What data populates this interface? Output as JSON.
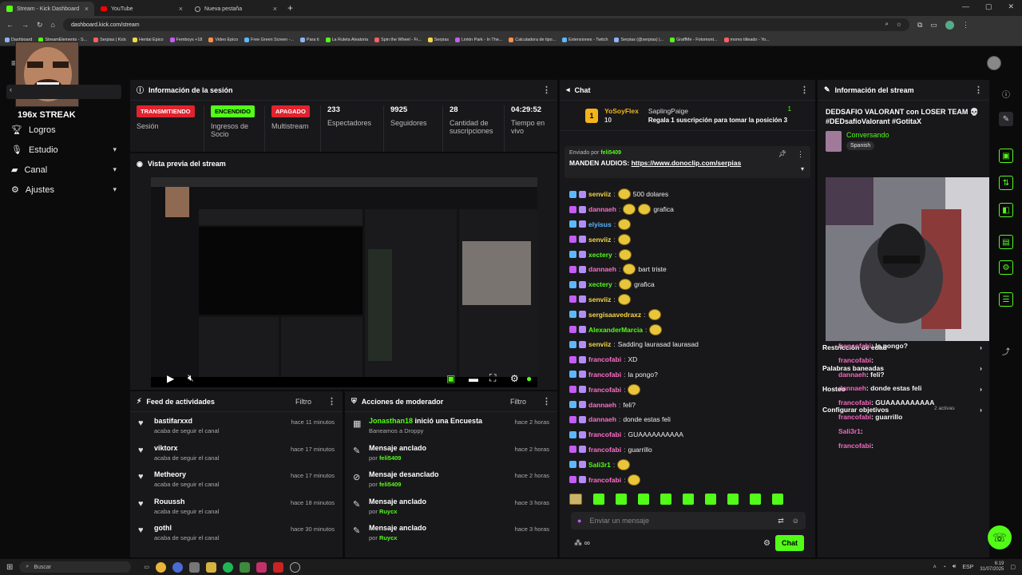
{
  "browser": {
    "tabs": [
      {
        "label": "Stream - Kick Dashboard",
        "color": "#53fc18"
      },
      {
        "label": "YouTube",
        "color": "#ff0000"
      },
      {
        "label": "Nueva pestaña",
        "color": "#5f6368"
      }
    ],
    "url": "dashboard.kick.com/stream",
    "bookmarks": [
      "Dashboard",
      "StreamElements - S...",
      "Serpias | Kick",
      "Hentai Epico",
      "Femboys +18",
      "Video Epico",
      "Free Green Screen -...",
      "Para ti",
      "La Ruleta Aleatoria",
      "Spin the Wheel - Fr...",
      "Serpias",
      "Linkin Park - In The...",
      "Calculadora de tipo...",
      "Extensiones - Twitch",
      "Serpias (@serpias) |...",
      "GraffMe - Fotomont...",
      "momo tilteado - Yo..."
    ]
  },
  "overlay": {
    "streak": "196x STREAK"
  },
  "nav": {
    "items": [
      {
        "label": "Logros",
        "chevron": false
      },
      {
        "label": "Estudio",
        "chevron": true
      },
      {
        "label": "Canal",
        "chevron": true
      },
      {
        "label": "Ajustes",
        "chevron": true
      }
    ]
  },
  "session": {
    "title": "Información de la sesión",
    "badges": [
      {
        "text": "TRANSMITIENDO",
        "label": "Sesión",
        "color": "#e0232e"
      },
      {
        "text": "ENCENDIDO",
        "label": "Ingresos de Socio",
        "color": "#53fc18"
      },
      {
        "text": "APAGADO",
        "label": "Multistream",
        "color": "#e0232e"
      }
    ],
    "stats": [
      {
        "value": "233",
        "label": "Espectadores"
      },
      {
        "value": "9925",
        "label": "Seguidores"
      },
      {
        "value": "28",
        "label": "Cantidad de suscripciones"
      },
      {
        "value": "04:29:52",
        "label": "Tiempo en vivo"
      }
    ]
  },
  "preview": {
    "title": "Vista previa del stream"
  },
  "activity": {
    "title": "Feed de actividades",
    "filter": "Filtro",
    "items": [
      {
        "user": "bastifarxxd",
        "action": "acaba de seguir el canal",
        "time": "hace 11 minutos"
      },
      {
        "user": "viktorx",
        "action": "acaba de seguir el canal",
        "time": "hace 17 minutos"
      },
      {
        "user": "Metheory",
        "action": "acaba de seguir el canal",
        "time": "hace 17 minutos"
      },
      {
        "user": "Rouussh",
        "action": "acaba de seguir el canal",
        "time": "hace 18 minutos"
      },
      {
        "user": "gothl",
        "action": "acaba de seguir el canal",
        "time": "hace 30 minutos"
      }
    ]
  },
  "modactions": {
    "title": "Acciones de moderador",
    "filter": "Filtro",
    "items": [
      {
        "title_user": "Jonasthan18",
        "title_rest": "inició una Encuesta",
        "sub_prefix": "",
        "sub_user": "",
        "sub_plain": "Baneamos a Droppy",
        "time": "hace 2 horas",
        "icon": "▦"
      },
      {
        "title_user": "",
        "title_rest": "Mensaje anclado",
        "sub_prefix": "por ",
        "sub_user": "feli5409",
        "sub_plain": "",
        "time": "hace 2 horas",
        "icon": "✎"
      },
      {
        "title_user": "",
        "title_rest": "Mensaje desanclado",
        "sub_prefix": "por ",
        "sub_user": "feli5409",
        "sub_plain": "",
        "time": "hace 2 horas",
        "icon": "⊘"
      },
      {
        "title_user": "",
        "title_rest": "Mensaje anclado",
        "sub_prefix": "por ",
        "sub_user": "Ruycx",
        "sub_plain": "",
        "time": "hace 3 horas",
        "icon": "✎"
      },
      {
        "title_user": "",
        "title_rest": "Mensaje anclado",
        "sub_prefix": "por ",
        "sub_user": "Ruycx",
        "sub_plain": "",
        "time": "hace 3 horas",
        "icon": "✎"
      }
    ]
  },
  "chat": {
    "title": "Chat",
    "top_gifter": {
      "name": "YoSoyFlex",
      "count": "10"
    },
    "gift": {
      "user": "SaplingPaige",
      "count": "1",
      "text": "Regala 1 suscripción para tomar la posición 3"
    },
    "pinned": {
      "sent_by_label": "Enviado por",
      "sent_by_user": "feli5409",
      "text": "MANDEN AUDIOS: ",
      "link": "https://www.donoclip.com/serpias"
    },
    "messages": [
      {
        "user": "senviiz",
        "color": "#f6d845",
        "text": "500 dolares",
        "emotes": 1
      },
      {
        "user": "dannaeh",
        "color": "#ff6ec7",
        "text": "grafica",
        "emotes": 2
      },
      {
        "user": "elyisus",
        "color": "#5db7ff",
        "text": "",
        "emotes": 1
      },
      {
        "user": "senviiz",
        "color": "#f6d845",
        "text": "",
        "emotes": 1
      },
      {
        "user": "xectery",
        "color": "#53fc18",
        "text": "",
        "emotes": 1
      },
      {
        "user": "dannaeh",
        "color": "#ff6ec7",
        "text": "bart triste",
        "emotes": 1
      },
      {
        "user": "xectery",
        "color": "#53fc18",
        "text": "grafica",
        "emotes": 1
      },
      {
        "user": "senviiz",
        "color": "#f6d845",
        "text": "",
        "emotes": 1
      },
      {
        "user": "sergisaavedraxz",
        "color": "#f6d845",
        "text": "",
        "emotes": 1
      },
      {
        "user": "AlexanderMarcia",
        "color": "#53fc18",
        "text": "",
        "emotes": 1
      },
      {
        "user": "senviiz",
        "color": "#f6d845",
        "text": "Sadding laurasad laurasad",
        "emotes": 0
      },
      {
        "user": "francofabi",
        "color": "#ff6ec7",
        "text": "XD",
        "emotes": 0
      },
      {
        "user": "francofabi",
        "color": "#ff6ec7",
        "text": "la pongo?",
        "emotes": 0
      },
      {
        "user": "francofabi",
        "color": "#ff6ec7",
        "text": "",
        "emotes": 1
      },
      {
        "user": "dannaeh",
        "color": "#ff6ec7",
        "text": "feli?",
        "emotes": 0
      },
      {
        "user": "dannaeh",
        "color": "#ff6ec7",
        "text": "donde estas feli",
        "emotes": 0
      },
      {
        "user": "francofabi",
        "color": "#ff6ec7",
        "text": "GUAAAAAAAAAA",
        "emotes": 0
      },
      {
        "user": "francofabi",
        "color": "#ff6ec7",
        "text": "guarrillo",
        "emotes": 0
      },
      {
        "user": "Sali3r1",
        "color": "#53fc18",
        "text": "",
        "emotes": 1
      },
      {
        "user": "francofabi",
        "color": "#ff6ec7",
        "text": "",
        "emotes": 1
      }
    ],
    "input_placeholder": "Enviar un mensaje",
    "send_label": "Chat"
  },
  "streaminfo": {
    "title": "Información del stream",
    "stream_title": "DEDSAFIO VALORANT con LOSER TEAM 💀 #DEDsafioValorant #GotitaX",
    "category": "Conversando",
    "language": "Spanish",
    "overlay_rows": [
      {
        "label": "Restricción de edad",
        "extra": ""
      },
      {
        "label": "Palabras baneadas",
        "extra": ""
      },
      {
        "label": "Hosteo",
        "extra": ""
      },
      {
        "label": "Configurar objetivos",
        "extra": "2 activas"
      }
    ],
    "overlay_chat": [
      {
        "user": "francofabi",
        "text": ": la pongo?"
      },
      {
        "user": "francofabi",
        "text": ":"
      },
      {
        "user": "dannaeh",
        "text": ": feli?"
      },
      {
        "user": "dannaeh",
        "text": ": donde estas feli"
      },
      {
        "user": "francofabi",
        "text": ": GUAAAAAAAAAA"
      },
      {
        "user": "francofabi",
        "text": ": guarrillo"
      },
      {
        "user": "Sali3r1",
        "text": ":"
      },
      {
        "user": "francofabi",
        "text": ":"
      }
    ]
  },
  "taskbar": {
    "search": "Buscar",
    "lang": "ESP",
    "time": "6:19",
    "date": "31/07/2025"
  }
}
